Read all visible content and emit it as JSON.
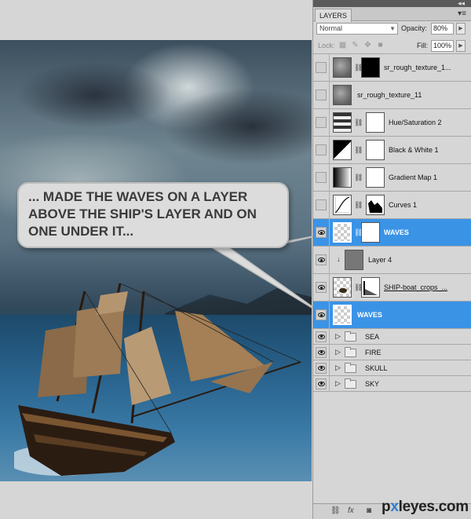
{
  "panel": {
    "tab_label": "LAYERS",
    "blend_mode": "Normal",
    "opacity_label": "Opacity:",
    "opacity_value": "80%",
    "lock_label": "Lock:",
    "fill_label": "Fill:",
    "fill_value": "100%"
  },
  "layers": [
    {
      "name": "sr_rough_texture_1...",
      "visible": false,
      "selected": false
    },
    {
      "name": "sr_rough_texture_11",
      "visible": false,
      "selected": false
    },
    {
      "name": "Hue/Saturation 2",
      "visible": false,
      "selected": false
    },
    {
      "name": "Black & White 1",
      "visible": false,
      "selected": false
    },
    {
      "name": "Gradient Map 1",
      "visible": false,
      "selected": false
    },
    {
      "name": "Curves 1",
      "visible": false,
      "selected": false
    },
    {
      "name": "WAVES",
      "visible": true,
      "selected": true
    },
    {
      "name": "Layer 4",
      "visible": true,
      "selected": false
    },
    {
      "name": "SHIP-boat_crops_...",
      "visible": true,
      "selected": false
    },
    {
      "name": "WAVES",
      "visible": true,
      "selected": true
    }
  ],
  "groups": [
    {
      "name": "SEA",
      "visible": true
    },
    {
      "name": "FIRE",
      "visible": true
    },
    {
      "name": "SKULL",
      "visible": true
    },
    {
      "name": "SKY",
      "visible": true
    }
  ],
  "callout": {
    "line1": "... MADE THE WAVES ON A LAYER",
    "line2": "ABOVE THE SHIP'S LAYER AND ON",
    "line3": "ONE UNDER IT..."
  },
  "footer_icons": [
    "link-icon",
    "fx-icon",
    "mask-icon"
  ],
  "watermark": {
    "pre": "p",
    "x": "x",
    "post": "leyes.com"
  },
  "colors": {
    "selected_layer": "#3b93e6",
    "panel_bg": "#d6d6d6"
  }
}
